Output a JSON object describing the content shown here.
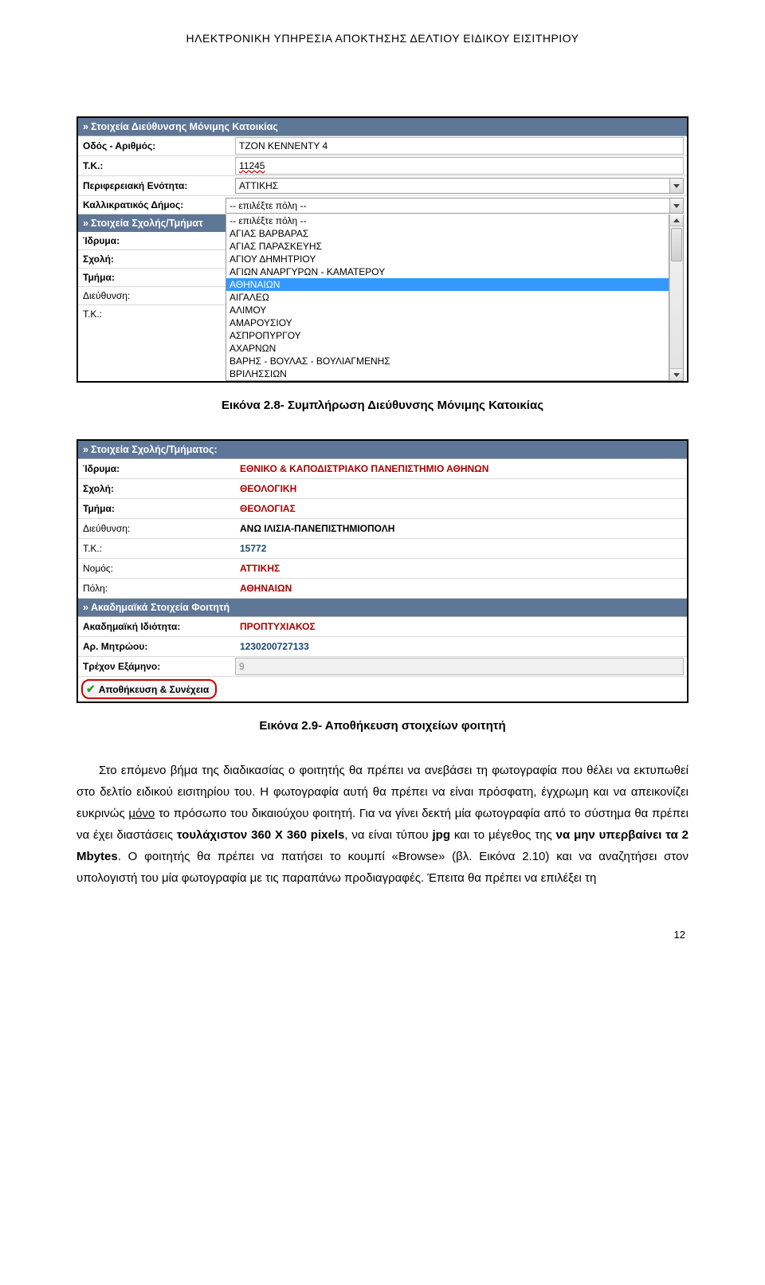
{
  "doc": {
    "header": "ΗΛΕΚΤΡΟΝΙΚΗ ΥΠΗΡΕΣΙΑ ΑΠΟΚΤΗΣΗΣ ΔΕΛΤΙΟΥ ΕΙΔΙΚΟΥ ΕΙΣΙΤΗΡΙΟΥ",
    "caption1": "Εικόνα 2.8- Συμπλήρωση Διεύθυνσης Μόνιμης Κατοικίας",
    "caption2": "Εικόνα 2.9- Αποθήκευση στοιχείων φοιτητή",
    "para1a": "Στο επόμενο βήμα της διαδικασίας ο φοιτητής θα πρέπει να ανεβάσει τη φωτογραφία που θέλει να εκτυπωθεί στο δελτίο ειδικού εισιτηρίου του. Η φωτογραφία αυτή θα πρέπει να είναι πρόσφατη, έγχρωμη και να απεικονίζει ευκρινώς ",
    "para1_under": "μόνο",
    "para1b": " το πρόσωπο του δικαιούχου φοιτητή. Για να γίνει δεκτή μία φωτογραφία από το σύστημα θα πρέπει να έχει διαστάσεις ",
    "dim_bold": "τουλάχιστον 360 X 360 pixels",
    "para1c": ", να είναι τύπου ",
    "jpg_bold": "jpg",
    "para1d": " και το μέγεθος της ",
    "size_bold": "να μην υπερβαίνει τα 2 Mbytes",
    "para1e": ". Ο φοιτητής θα πρέπει να πατήσει το κουμπί «Browse» (βλ. Εικόνα 2.10) και να αναζητήσει στον υπολογιστή του μία φωτογραφία με τις παραπάνω προδιαγραφές. Έπειτα θα πρέπει να επιλέξει τη",
    "pagenum": "12"
  },
  "fig1": {
    "section_address": "Στοιχεία Διεύθυνσης Μόνιμης Κατοικίας",
    "street_label": "Οδός - Αριθμός:",
    "street_value": "ΤΖΟΝ ΚΕΝΝΕΝΤΥ 4",
    "tk_label": "Τ.Κ.:",
    "tk_value": "11245",
    "peri_label": "Περιφερειακή Ενότητα:",
    "peri_value": "ΑΤΤΙΚΗΣ",
    "city_label": "Καλλικρατικός Δήμος:",
    "city_options": [
      "-- επιλέξτε πόλη --",
      "-- επιλέξτε πόλη --",
      "ΑΓΙΑΣ ΒΑΡΒΑΡΑΣ",
      "ΑΓΙΑΣ ΠΑΡΑΣΚΕΥΗΣ",
      "ΑΓΙΟΥ ΔΗΜΗΤΡΙΟΥ",
      "ΑΓΙΩΝ ΑΝΑΡΓΥΡΩΝ - ΚΑΜΑΤΕΡΟΥ",
      "ΑΘΗΝΑΙΩΝ",
      "ΑΙΓΑΛΕΩ",
      "ΑΛΙΜΟΥ",
      "ΑΜΑΡΟΥΣΙΟΥ",
      "ΑΣΠΡΟΠΥΡΓΟΥ",
      "ΑΧΑΡΝΩΝ",
      "ΒΑΡΗΣ - ΒΟΥΛΑΣ - ΒΟΥΛΙΑΓΜΕΝΗΣ",
      "ΒΡΙΛΗΣΣΙΩΝ"
    ],
    "section_school": "Στοιχεία Σχολής/Τμήματ",
    "idryma_label": "Ίδρυμα:",
    "scholi_label": "Σχολή:",
    "tmima_label": "Τμήμα:",
    "address2_label": "Διεύθυνση:",
    "tk2_label": "Τ.Κ.:"
  },
  "fig2": {
    "section_school": "Στοιχεία Σχολής/Τμήματος:",
    "idryma_label": "Ίδρυμα:",
    "idryma_value": "ΕΘΝΙΚΟ & ΚΑΠΟΔΙΣΤΡΙΑΚΟ ΠΑΝΕΠΙΣΤΗΜΙΟ ΑΘΗΝΩΝ",
    "scholi_label": "Σχολή:",
    "scholi_value": "ΘΕΟΛΟΓΙΚΗ",
    "tmima_label": "Τμήμα:",
    "tmima_value": "ΘΕΟΛΟΓΙΑΣ",
    "address_label": "Διεύθυνση:",
    "address_value": "ΑΝΩ ΙΛΙΣΙΑ-ΠΑΝΕΠΙΣΤΗΜΙΟΠΟΛΗ",
    "tk_label": "Τ.Κ.:",
    "tk_value": "15772",
    "nomos_label": "Νομός:",
    "nomos_value": "ΑΤΤΙΚΗΣ",
    "poli_label": "Πόλη:",
    "poli_value": "ΑΘΗΝΑΙΩΝ",
    "section_acad": "Ακαδημαϊκά Στοιχεία Φοιτητή",
    "idio_label": "Ακαδημαϊκή Ιδιότητα:",
    "idio_value": "ΠΡΟΠΤΥΧΙΑΚΟΣ",
    "am_label": "Αρ. Μητρώου:",
    "am_value": "1230200727133",
    "sem_label": "Τρέχον Εξάμηνο:",
    "sem_value": "9",
    "save_label": "Αποθήκευση & Συνέχεια"
  }
}
